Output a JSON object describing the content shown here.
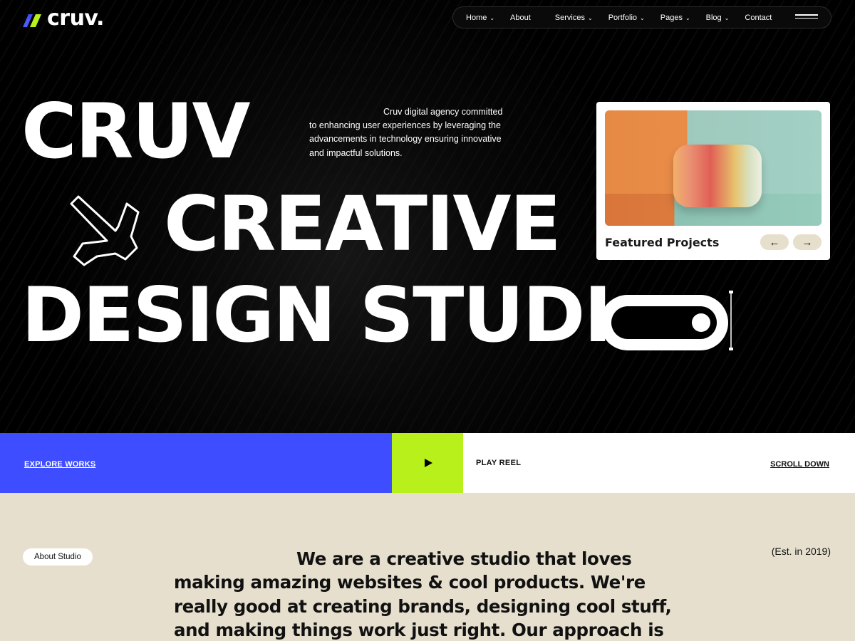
{
  "logo": {
    "text": "cruv."
  },
  "nav": {
    "items": [
      {
        "label": "Home",
        "dropdown": true
      },
      {
        "label": "About",
        "dropdown": false
      },
      {
        "label": "Services",
        "dropdown": true
      },
      {
        "label": "Portfolio",
        "dropdown": true
      },
      {
        "label": "Pages",
        "dropdown": true
      },
      {
        "label": "Blog",
        "dropdown": true
      },
      {
        "label": "Contact",
        "dropdown": false
      }
    ],
    "chevron": "⌄"
  },
  "hero": {
    "line1": "CRUV",
    "line2": "CREATIVE",
    "line3": "DESIGN STUDI",
    "description": "Cruv digital agency committed to enhancing user experiences by leveraging the advancements in technology ensuring innovative and impactful solutions."
  },
  "featured": {
    "title": "Featured Projects",
    "prev_icon": "←",
    "next_icon": "→"
  },
  "strip": {
    "explore": "EXPLORE WORKS",
    "play_reel": "PLAY REEL",
    "scroll_down": "SCROLL DOWN"
  },
  "about": {
    "badge": "About Studio",
    "est": "(Est. in 2019)",
    "text": "We are a creative studio that loves making amazing websites & cool products. We're really good at creating brands, designing cool stuff, and making things work just right. Our approach is all about understanding"
  },
  "colors": {
    "brand_blue": "#3d4dff",
    "accent_lime": "#b8f01b",
    "about_bg": "#e6dfcd"
  }
}
